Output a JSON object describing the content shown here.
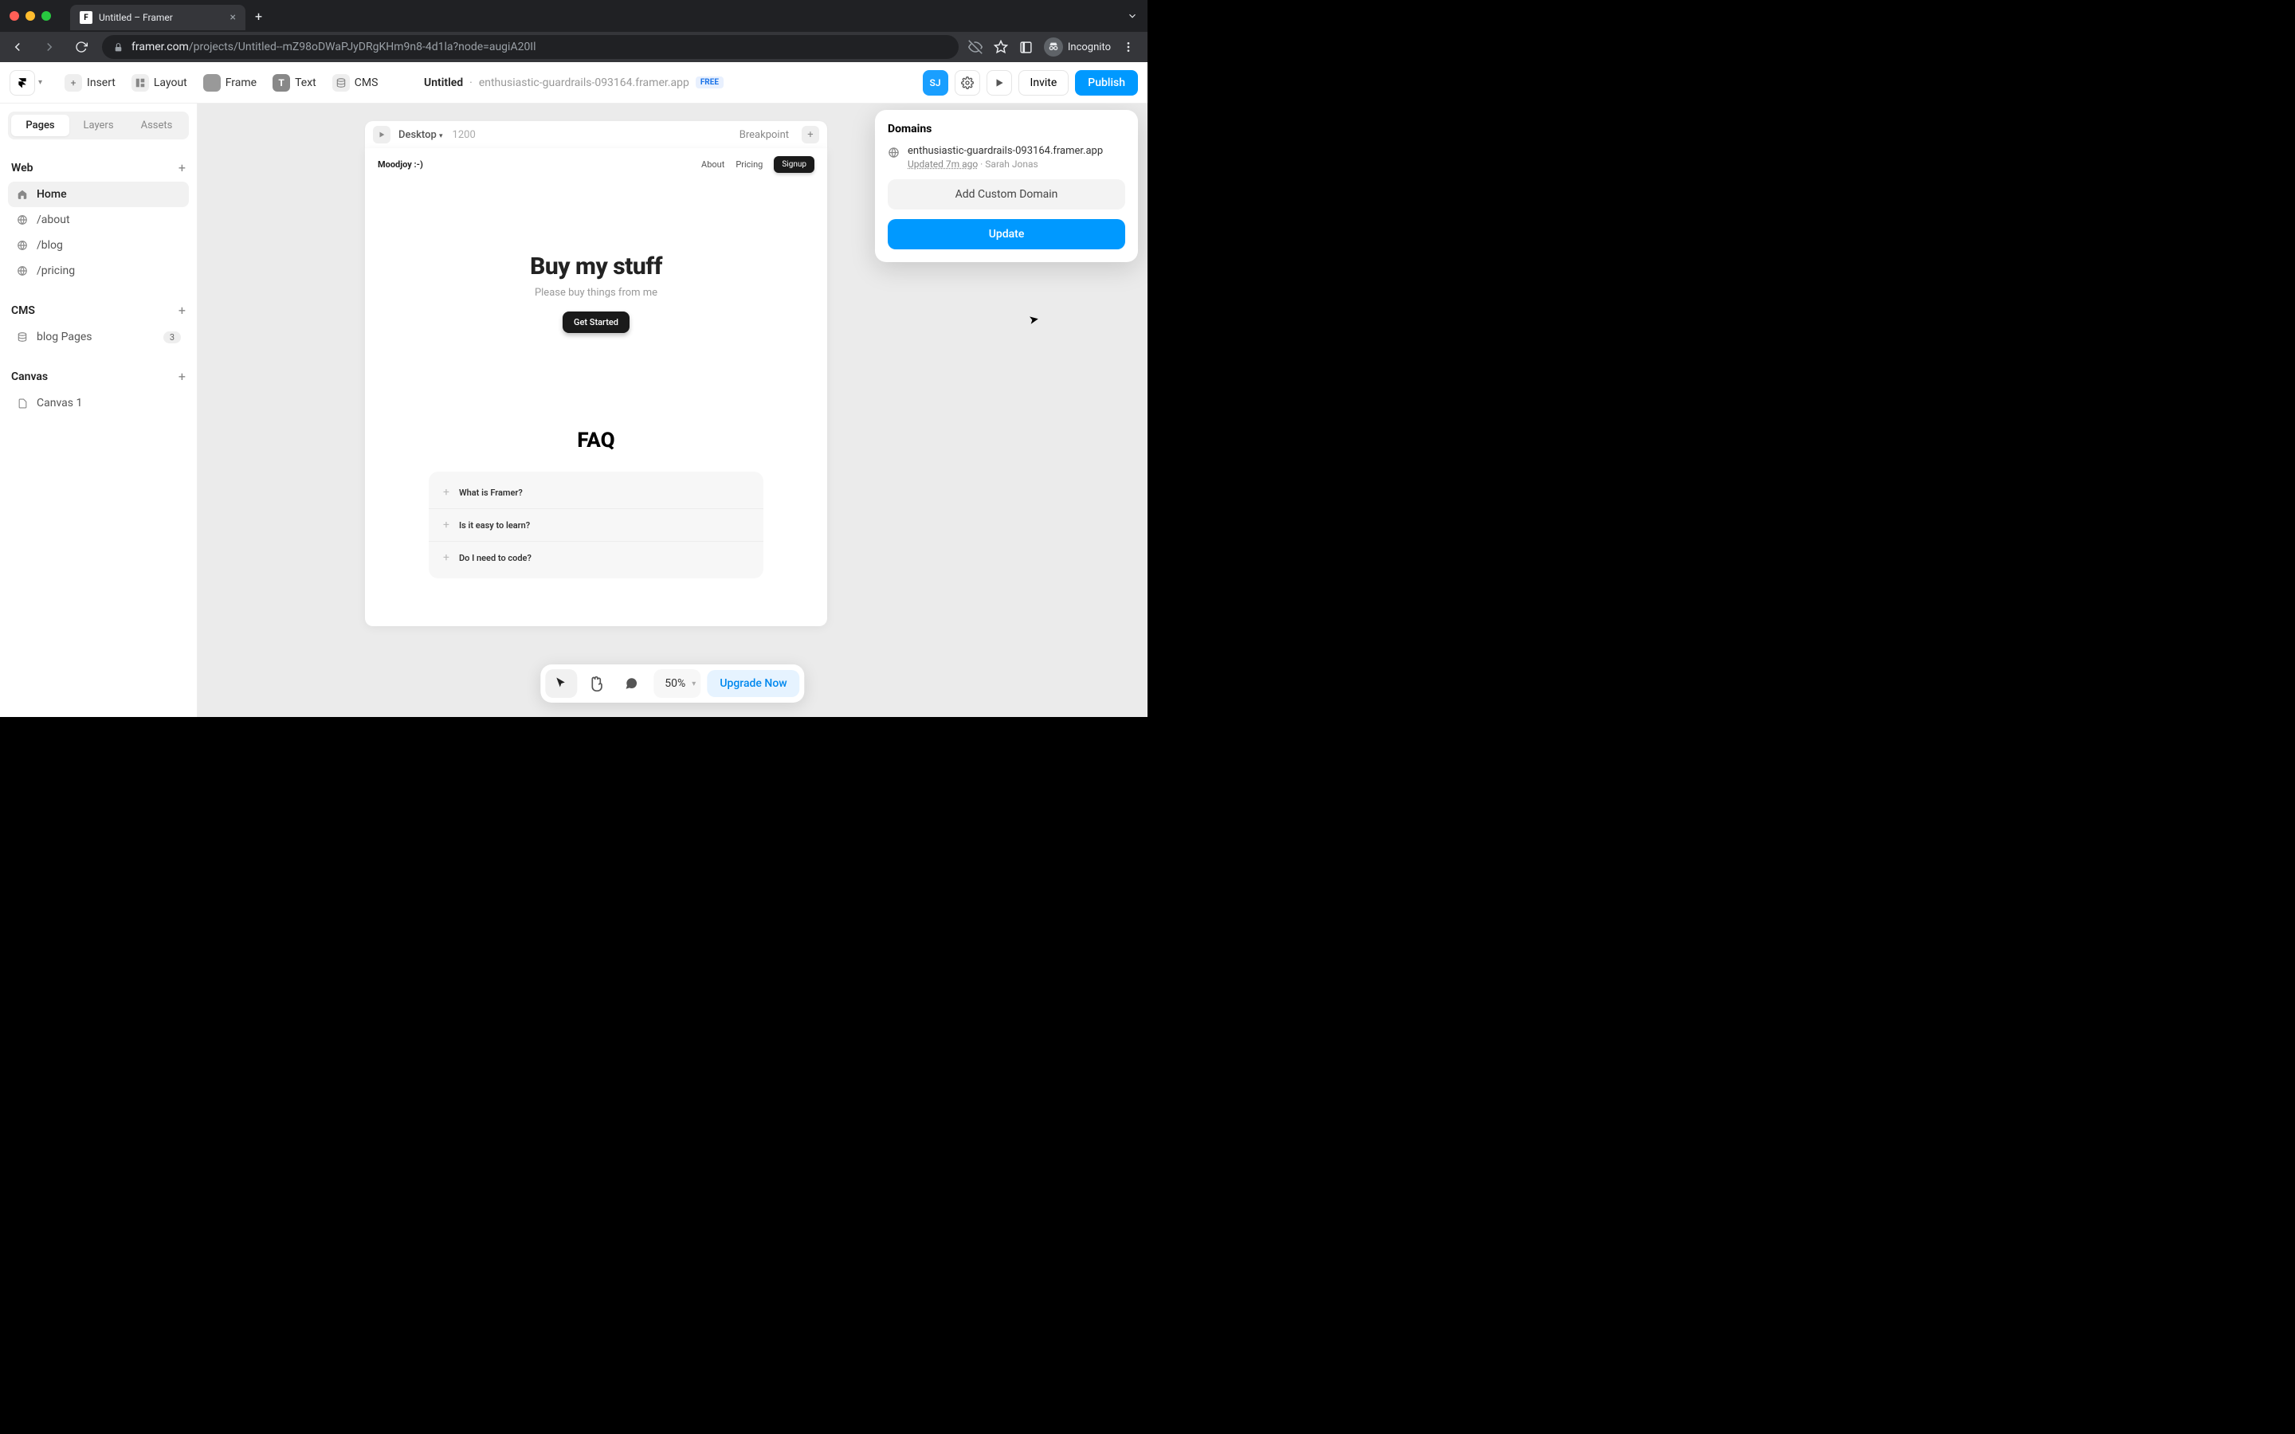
{
  "browser": {
    "tab_title": "Untitled – Framer",
    "url_domain": "framer.com",
    "url_path": "/projects/Untitled--mZ98oDWaPJyDRgKHm9n8-4d1la?node=augiA20Il",
    "incognito_label": "Incognito"
  },
  "toolbar": {
    "insert": "Insert",
    "layout": "Layout",
    "frame": "Frame",
    "text": "Text",
    "cms": "CMS",
    "project_name": "Untitled",
    "project_url": "enthusiastic-guardrails-093164.framer.app",
    "free_badge": "FREE",
    "avatar_initials": "SJ",
    "invite": "Invite",
    "publish": "Publish"
  },
  "sidebar": {
    "tabs": {
      "pages": "Pages",
      "layers": "Layers",
      "assets": "Assets"
    },
    "web_heading": "Web",
    "pages": [
      {
        "icon": "home",
        "label": "Home",
        "active": true
      },
      {
        "icon": "globe",
        "label": "/about"
      },
      {
        "icon": "globe",
        "label": "/blog"
      },
      {
        "icon": "globe",
        "label": "/pricing"
      }
    ],
    "cms_heading": "CMS",
    "cms_items": [
      {
        "label": "blog Pages",
        "count": "3"
      }
    ],
    "canvas_heading": "Canvas",
    "canvas_items": [
      {
        "label": "Canvas 1"
      }
    ]
  },
  "frame": {
    "breakpoint_name": "Desktop",
    "breakpoint_width": "1200",
    "breakpoint_label": "Breakpoint"
  },
  "site": {
    "brand": "Moodjoy :-)",
    "nav": {
      "about": "About",
      "pricing": "Pricing",
      "signup": "Signup"
    },
    "hero_title": "Buy my stuff",
    "hero_subtitle": "Please buy things from me",
    "hero_cta": "Get Started",
    "faq_heading": "FAQ",
    "faq_items": [
      "What is Framer?",
      "Is it easy to learn?",
      "Do I need to code?"
    ]
  },
  "popover": {
    "title": "Domains",
    "domain": "enthusiastic-guardrails-093164.framer.app",
    "updated": "Updated 7m ago",
    "author": "Sarah Jonas",
    "add_custom": "Add Custom Domain",
    "update": "Update"
  },
  "bottombar": {
    "zoom": "50%",
    "upgrade": "Upgrade Now"
  }
}
